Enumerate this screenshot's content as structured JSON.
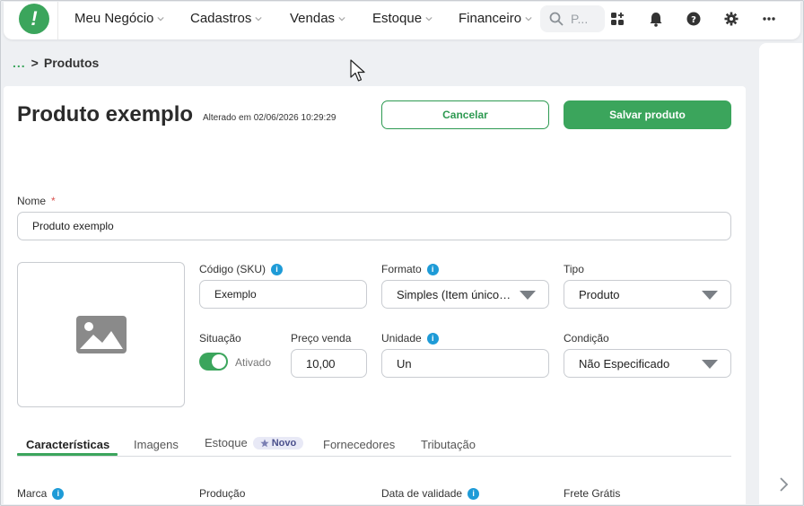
{
  "nav": {
    "logo_glyph": "!",
    "items": [
      {
        "label": "Meu Negócio"
      },
      {
        "label": "Cadastros"
      },
      {
        "label": "Vendas"
      },
      {
        "label": "Estoque"
      },
      {
        "label": "Financeiro"
      }
    ],
    "search_placeholder": "P...",
    "icons": [
      "apps-icon",
      "bell-icon",
      "help-icon",
      "gear-icon",
      "more-icon"
    ]
  },
  "breadcrumb": {
    "ellipsis": "...",
    "separator": ">",
    "current": "Produtos"
  },
  "header": {
    "title": "Produto exemplo",
    "changed_at": "Alterado em 02/06/2026 10:29:29",
    "cancel_label": "Cancelar",
    "save_label": "Salvar produto"
  },
  "form": {
    "nome_label": "Nome",
    "required_mark": "*",
    "nome_value": "Produto exemplo",
    "sku_label": "Código (SKU)",
    "sku_value": "Exemplo",
    "formato_label": "Formato",
    "formato_value": "Simples (Item único e...",
    "tipo_label": "Tipo",
    "tipo_value": "Produto",
    "situacao_label": "Situação",
    "situacao_value": "Ativado",
    "preco_label": "Preço venda",
    "preco_value": "10,00",
    "unidade_label": "Unidade",
    "unidade_value": "Un",
    "condicao_label": "Condição",
    "condicao_value": "Não Especificado"
  },
  "tabs": [
    {
      "label": "Características",
      "active": true
    },
    {
      "label": "Imagens"
    },
    {
      "label": "Estoque",
      "badge": "Novo"
    },
    {
      "label": "Fornecedores"
    },
    {
      "label": "Tributação"
    }
  ],
  "section": {
    "marca_label": "Marca",
    "producao_label": "Produção",
    "validade_label": "Data de validade",
    "frete_label": "Frete Grátis"
  },
  "colors": {
    "accent": "#3ba55c",
    "info": "#1e9bd7"
  }
}
